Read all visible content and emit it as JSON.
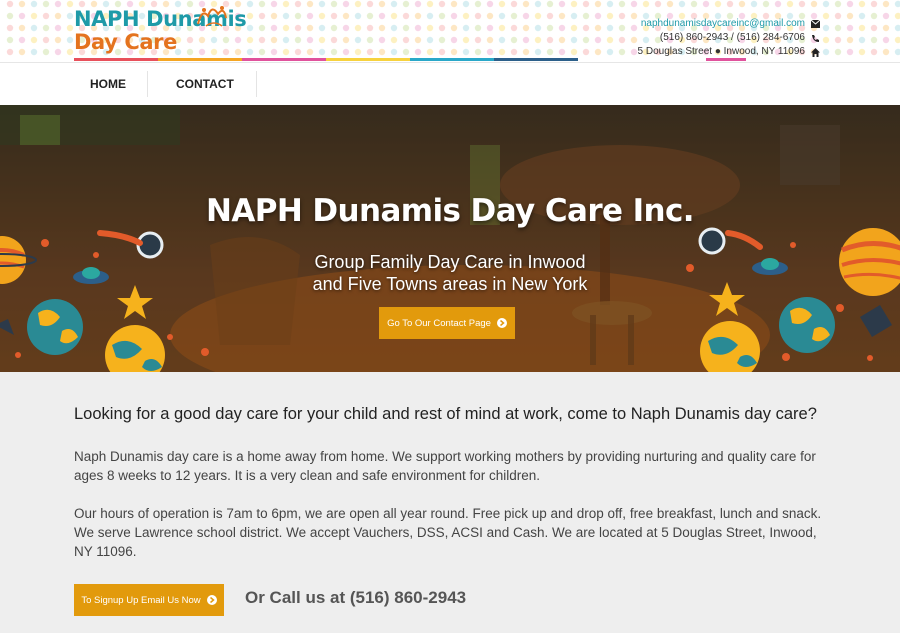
{
  "brand": {
    "logo_line1": "NAPH Dunamis",
    "logo_line2": "Day Care",
    "colors": {
      "teal": "#1e9aa8",
      "orange": "#e4731e",
      "button": "#e29a0c"
    }
  },
  "contact": {
    "email": "naphdunamisdaycareinc@gmail.com",
    "phone": "(516) 860-2943 / (516) 284-6706",
    "address": "5 Douglas Street ● Inwood, NY 11096",
    "icons": [
      "envelope-icon",
      "phone-icon",
      "home-icon"
    ]
  },
  "nav": {
    "items": [
      {
        "label": "HOME"
      },
      {
        "label": "CONTACT"
      }
    ]
  },
  "hero": {
    "title": "NAPH Dunamis Day Care Inc.",
    "subtitle_line1": "Group Family Day Care in Inwood",
    "subtitle_line2": "and Five Towns areas in New York",
    "button_label": "Go To Our Contact Page"
  },
  "main": {
    "headline": "Looking for a good day care for your child and rest of mind at work, come to Naph Dunamis day care?",
    "paragraph1": "Naph Dunamis day care is a home away from home. We support working mothers by providing nurturing and quality care for ages 8 weeks to 12 years. It is a very clean and safe environment for children.",
    "paragraph2": "Our hours of operation is 7am to 6pm, we are open all year round. Free pick up and drop off, free breakfast, lunch and snack. We serve Lawrence school district. We accept Vauchers, DSS, ACSI and Cash. We are located at 5 Douglas Street, Inwood, NY 11096.",
    "signup_label": "To Signup Up Email Us Now",
    "call_text": "Or Call us at (516) 860-2943"
  }
}
